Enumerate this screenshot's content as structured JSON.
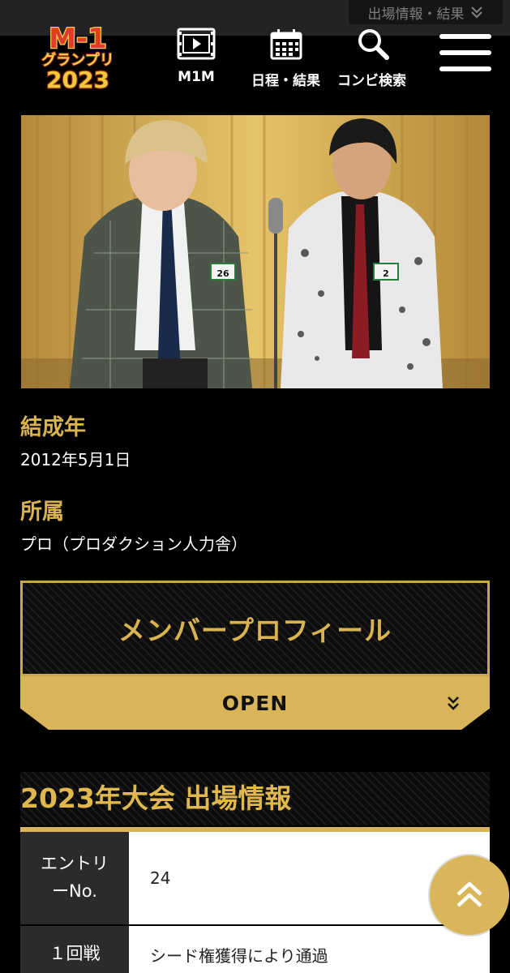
{
  "topbar": {
    "tab_label": "出場情報・結果"
  },
  "header": {
    "logo": {
      "line1": "M-1",
      "line2": "グランプリ",
      "line3": "2023"
    },
    "nav": [
      {
        "label": "M1M",
        "icon": "film-play-icon"
      },
      {
        "label": "日程・結果",
        "icon": "calendar-icon"
      },
      {
        "label": "コンビ検索",
        "icon": "search-icon"
      }
    ],
    "menu_icon": "hamburger-menu-icon"
  },
  "hero": {
    "badge_left": "26",
    "badge_right": "2"
  },
  "info": {
    "formed_label": "結成年",
    "formed_value": "2012年5月1日",
    "agency_label": "所属",
    "agency_value": "プロ（プロダクション人力舎）"
  },
  "profile": {
    "title": "メンバープロフィール",
    "open_label": "OPEN"
  },
  "entry": {
    "section_title": "2023年大会 出場情報",
    "rows": [
      {
        "label_1": "エントリ",
        "label_2": "ーNo.",
        "value": "24"
      },
      {
        "label_1": "１回戦",
        "label_2": "",
        "value": "シード権獲得により通過"
      }
    ]
  },
  "colors": {
    "gold": "#d7b558",
    "gold_text": "#d9b350",
    "background": "#000000"
  }
}
